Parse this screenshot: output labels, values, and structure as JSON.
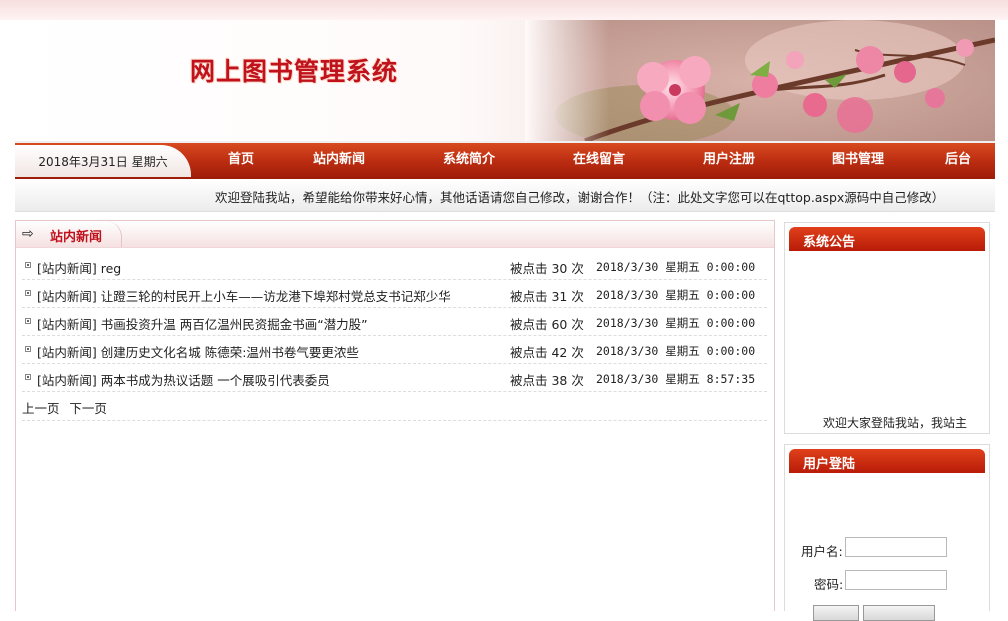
{
  "header": {
    "title": "网上图书管理系统"
  },
  "nav": {
    "date": "2018年3月31日 星期六",
    "items": [
      "首页",
      "站内新闻",
      "系统简介",
      "在线留言",
      "用户注册",
      "图书管理",
      "后台"
    ]
  },
  "welcome": "欢迎登陆我站，希望能给你带来好心情，其他话语请您自己修改，谢谢合作！（注：此处文字您可以在qttop.aspx源码中自己修改）",
  "main": {
    "section_title": "站内新闻",
    "news": [
      {
        "title": "[站内新闻] reg",
        "clicks": "被点击 30 次",
        "date": "2018/3/30 星期五 0:00:00"
      },
      {
        "title": "[站内新闻] 让蹬三轮的村民开上小车——访龙港下埠郑村党总支书记郑少华",
        "clicks": "被点击 31 次",
        "date": "2018/3/30 星期五 0:00:00"
      },
      {
        "title": "[站内新闻] 书画投资升温 两百亿温州民资掘金书画“潜力股”",
        "clicks": "被点击 60 次",
        "date": "2018/3/30 星期五 0:00:00"
      },
      {
        "title": "[站内新闻] 创建历史文化名城 陈德荣:温州书卷气要更浓些",
        "clicks": "被点击 42 次",
        "date": "2018/3/30 星期五 0:00:00"
      },
      {
        "title": "[站内新闻] 两本书成为热议话题 一个展吸引代表委员",
        "clicks": "被点击 38 次",
        "date": "2018/3/30 星期五 8:57:35"
      }
    ],
    "pager": {
      "prev": "上一页",
      "next": "下一页"
    }
  },
  "sidebar": {
    "notice_title": "系统公告",
    "notice_text": "欢迎大家登陆我站，我站主",
    "login_title": "用户登陆",
    "username_label": "用户名:",
    "password_label": "密码:"
  },
  "colors": {
    "brand_red": "#c0121c",
    "nav_red": "#b92b10"
  }
}
